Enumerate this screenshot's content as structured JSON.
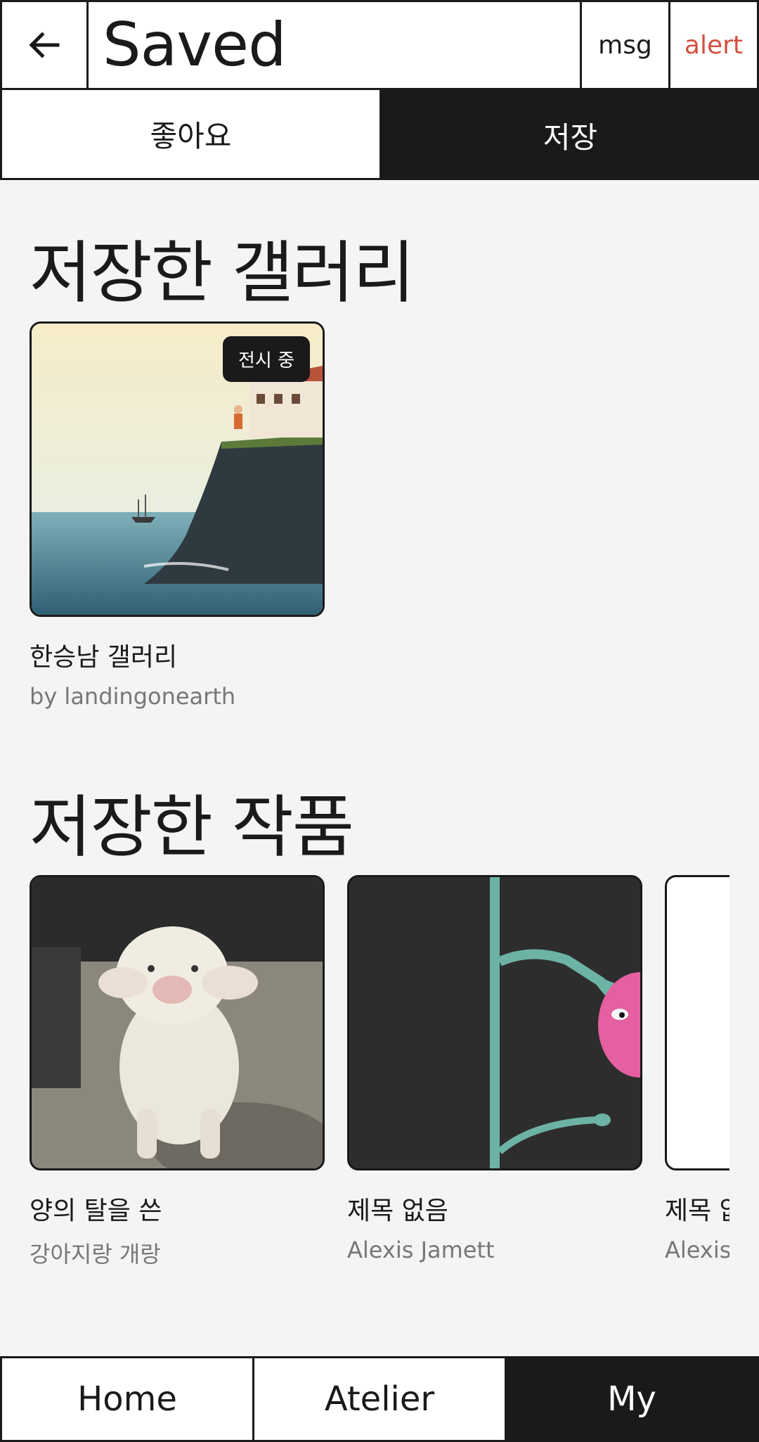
{
  "header": {
    "title": "Saved",
    "back_icon": "arrow-left-icon",
    "msg_label": "msg",
    "alert_label": "alert"
  },
  "tabs": [
    {
      "label": "좋아요",
      "active": false
    },
    {
      "label": "저장",
      "active": true
    }
  ],
  "galleries": {
    "heading": "저장한 갤러리",
    "items": [
      {
        "title": "한승남 갤러리",
        "subtitle": "by landingonearth",
        "badge": "전시 중"
      }
    ]
  },
  "artworks": {
    "heading": "저장한 작품",
    "items": [
      {
        "title": "양의 탈을 쓴",
        "artist": "강아지랑 개랑"
      },
      {
        "title": "제목 없음",
        "artist": "Alexis Jamett"
      },
      {
        "title": "제목 없음",
        "artist": "Alexis Jamett"
      }
    ]
  },
  "bottom_nav": {
    "items": [
      {
        "label": "Home",
        "active": false
      },
      {
        "label": "Atelier",
        "active": false
      },
      {
        "label": "My",
        "active": true
      }
    ]
  },
  "colors": {
    "ink": "#1a1a1a",
    "background": "#f4f4f4",
    "alert": "#d2503f",
    "muted_text": "#777777"
  }
}
